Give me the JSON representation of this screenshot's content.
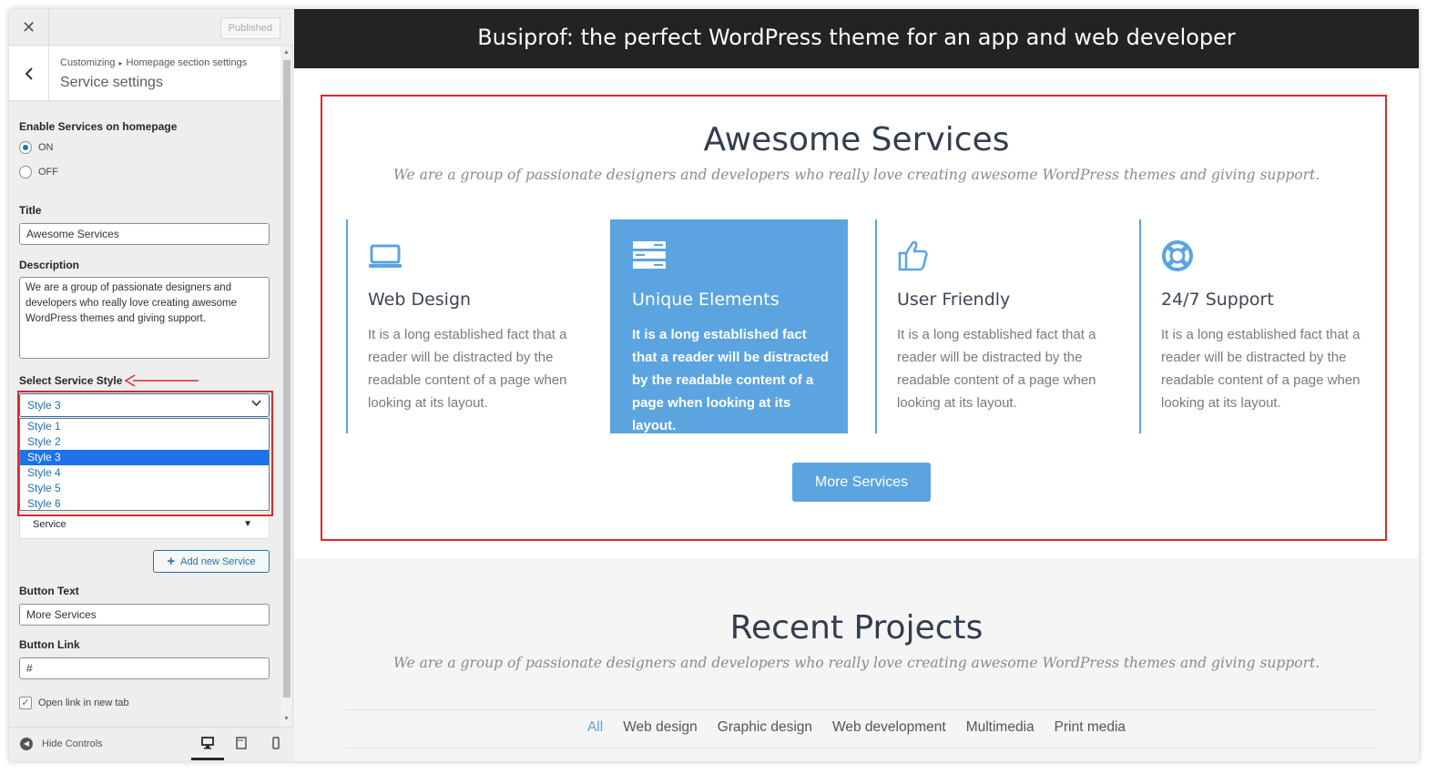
{
  "sidebar": {
    "close_label": "✕",
    "published_label": "Published",
    "back_label": "‹",
    "breadcrumb": [
      "Customizing",
      "Homepage section settings"
    ],
    "breadcrumb_sep": "▸",
    "section_title": "Service settings",
    "enable_label": "Enable Services on homepage",
    "radio_on": "ON",
    "radio_off": "OFF",
    "enable_value": "ON",
    "title_label": "Title",
    "title_value": "Awesome Services",
    "description_label": "Description",
    "description_value": "We are a group of passionate designers and developers who really love creating awesome WordPress themes and giving support.",
    "style_label": "Select Service Style",
    "style_selected": "Style 3",
    "style_options": [
      "Style 1",
      "Style 2",
      "Style 3",
      "Style 4",
      "Style 5",
      "Style 6"
    ],
    "service_accordion": "Service",
    "add_service_label": "Add new Service",
    "button_text_label": "Button Text",
    "button_text_value": "More Services",
    "button_link_label": "Button Link",
    "button_link_value": "#",
    "open_new_tab_label": "Open link in new tab",
    "open_new_tab_checked": true,
    "hide_controls_label": "Hide Controls",
    "accent_color": "#2271b1",
    "highlight_color": "#e0272a"
  },
  "preview": {
    "header_title": "Busiprof: the perfect WordPress theme for an app and web developer",
    "services": {
      "title": "Awesome Services",
      "description": "We are a group of passionate designers and developers who really love creating awesome WordPress themes and giving support.",
      "cards": [
        {
          "icon": "laptop-icon",
          "title": "Web Design",
          "text": "It is a long established fact that a reader will be distracted by the readable content of a page when looking at its layout."
        },
        {
          "icon": "server-icon",
          "title": "Unique Elements",
          "text": "It is a long established fact that a reader will be distracted by the readable content of a page when looking at its layout."
        },
        {
          "icon": "thumbs-up-icon",
          "title": "User Friendly",
          "text": "It is a long established fact that a reader will be distracted by the readable content of a page when looking at its layout."
        },
        {
          "icon": "lifebuoy-icon",
          "title": "24/7 Support",
          "text": "It is a long established fact that a reader will be distracted by the readable content of a page when looking at its layout."
        }
      ],
      "button_label": "More Services",
      "accent_color": "#5ba4e0"
    },
    "projects": {
      "title": "Recent Projects",
      "description": "We are a group of passionate designers and developers who really love creating awesome WordPress themes and giving support.",
      "filters": [
        "All",
        "Web design",
        "Graphic design",
        "Web development",
        "Multimedia",
        "Print media"
      ],
      "active_filter": "All"
    }
  }
}
